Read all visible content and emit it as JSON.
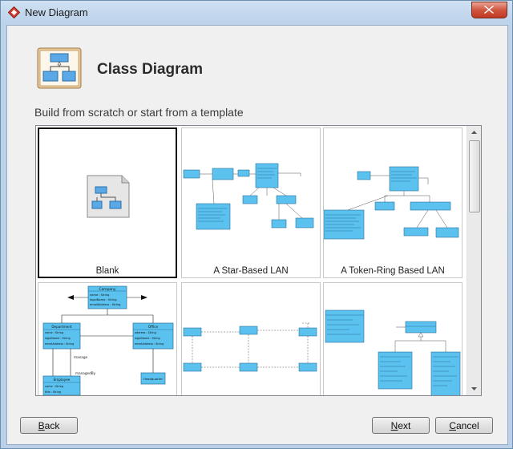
{
  "window": {
    "title": "New Diagram"
  },
  "header": {
    "title": "Class Diagram",
    "icon": "class-diagram-icon"
  },
  "subtitle": "Build from scratch or start from a template",
  "templates": [
    {
      "label": "Blank",
      "selected": true,
      "icon": "blank-diagram-icon"
    },
    {
      "label": "A Star-Based LAN",
      "selected": false
    },
    {
      "label": "A Token-Ring Based LAN",
      "selected": false
    },
    {
      "label": "",
      "selected": false
    },
    {
      "label": "",
      "selected": false
    },
    {
      "label": "",
      "selected": false
    }
  ],
  "previews": {
    "company": {
      "title": "Company",
      "attrs": [
        "name : String",
        "legalName : String",
        "emailAddress : String"
      ]
    },
    "department": {
      "title": "Department",
      "attrs": [
        "name : String",
        "legalName : String",
        "emailAddress : String"
      ]
    },
    "office": {
      "title": "Office",
      "attrs": [
        "address : String",
        "legalName : String",
        "emailAddress : String"
      ]
    },
    "headquarter": {
      "title": "Headquarter"
    },
    "employee": {
      "title": "Employee",
      "attrs": [
        "name : String",
        "title : String"
      ]
    },
    "manage": "manage",
    "managedBy": "managedBy"
  },
  "buttons": {
    "back": {
      "mn": "B",
      "rest": "ack"
    },
    "next": {
      "mn": "N",
      "rest": "ext"
    },
    "cancel": {
      "mn": "C",
      "rest": "ancel"
    }
  },
  "colors": {
    "umlFill": "#5bc2f0",
    "umlBorder": "#2a6f96",
    "selectedBorder": "#111111"
  }
}
